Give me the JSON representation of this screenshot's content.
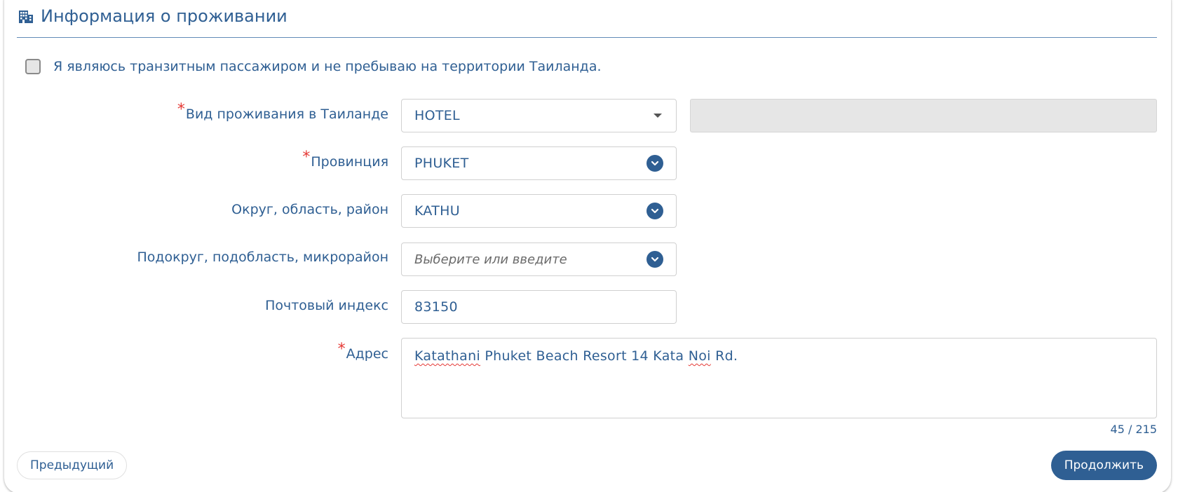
{
  "section": {
    "title": "Информация о проживании",
    "icon": "building-icon"
  },
  "transit": {
    "label": "Я являюсь транзитным пассажиром и не пребываю на территории Таиланда.",
    "checked": false
  },
  "required_mark": "*",
  "fields": {
    "accommodation_type": {
      "label": "Вид проживания в Таиланде",
      "value": "HOTEL",
      "required": true
    },
    "province": {
      "label": "Провинция",
      "value": "PHUKET",
      "required": true
    },
    "district": {
      "label": "Округ, область, район",
      "value": "KATHU",
      "required": false
    },
    "subdistrict": {
      "label": "Подокруг, подобласть, микрорайон",
      "placeholder": "Выберите или введите",
      "required": false
    },
    "postal_code": {
      "label": "Почтовый индекс",
      "value": "83150",
      "required": false
    },
    "address": {
      "label": "Адрес",
      "value_parts": [
        "Katathani",
        " Phuket Beach Resort 14 Kata ",
        "Noi",
        " Rd."
      ],
      "counter": "45 / 215",
      "required": true
    }
  },
  "buttons": {
    "previous": "Предыдущий",
    "continue": "Продолжить"
  },
  "colors": {
    "primary": "#2f5f93",
    "required": "#e53935"
  }
}
